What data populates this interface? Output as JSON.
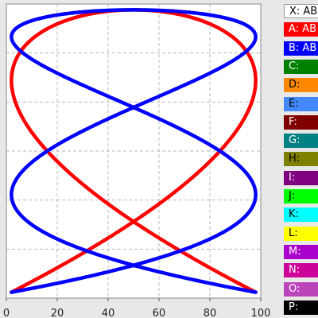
{
  "chart_data": {
    "type": "line",
    "title": "",
    "xlabel": "",
    "ylabel": "",
    "xlim": [
      0,
      100
    ],
    "ylim": [
      0,
      100
    ],
    "x_ticks": [
      "0",
      "20",
      "40",
      "60",
      "80",
      "100"
    ],
    "grid": true,
    "series": [
      {
        "channel": "A",
        "color": "#ff0000",
        "x_cycles": 3,
        "y_cycles": 2
      },
      {
        "channel": "B",
        "color": "#0000ff",
        "x_cycles": 5,
        "y_cycles": 2
      }
    ]
  },
  "legend": {
    "placement": "right",
    "items": [
      {
        "label": "X: AB",
        "bg": "#ffffff",
        "fg": "#000000"
      },
      {
        "label": "A: AB",
        "bg": "#ff0000",
        "fg": "#ffffff"
      },
      {
        "label": "B: AB",
        "bg": "#0000ff",
        "fg": "#ffffff"
      },
      {
        "label": "C:",
        "bg": "#008000",
        "fg": "#ffffff"
      },
      {
        "label": "D:",
        "bg": "#ff8800",
        "fg": "#000000"
      },
      {
        "label": "E:",
        "bg": "#4488ff",
        "fg": "#000000"
      },
      {
        "label": "F:",
        "bg": "#800000",
        "fg": "#ffffff"
      },
      {
        "label": "G:",
        "bg": "#008080",
        "fg": "#ffffff"
      },
      {
        "label": "H:",
        "bg": "#808000",
        "fg": "#000000"
      },
      {
        "label": "I:",
        "bg": "#800080",
        "fg": "#ffffff"
      },
      {
        "label": "J:",
        "bg": "#00ff00",
        "fg": "#000000"
      },
      {
        "label": "K:",
        "bg": "#00ffff",
        "fg": "#000000"
      },
      {
        "label": "L:",
        "bg": "#ffff00",
        "fg": "#000000"
      },
      {
        "label": "M:",
        "bg": "#aa00cc",
        "fg": "#ffffff"
      },
      {
        "label": "N:",
        "bg": "#cc0099",
        "fg": "#ffffff"
      },
      {
        "label": "O:",
        "bg": "#bb44bb",
        "fg": "#ffffff"
      },
      {
        "label": "P:",
        "bg": "#000000",
        "fg": "#ffffff"
      }
    ]
  }
}
